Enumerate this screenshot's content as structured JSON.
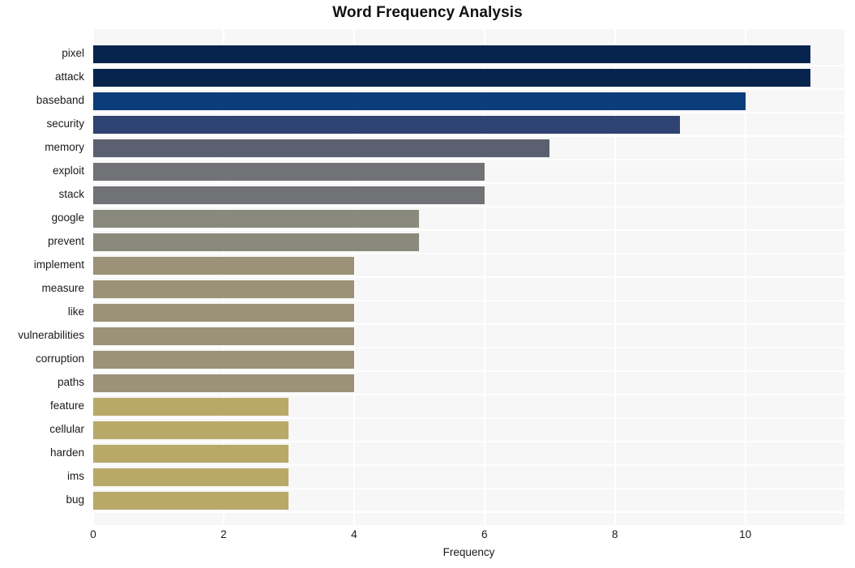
{
  "chart_data": {
    "type": "bar",
    "orientation": "horizontal",
    "title": "Word Frequency Analysis",
    "xlabel": "Frequency",
    "ylabel": "",
    "categories": [
      "pixel",
      "attack",
      "baseband",
      "security",
      "memory",
      "exploit",
      "stack",
      "google",
      "prevent",
      "implement",
      "measure",
      "like",
      "vulnerabilities",
      "corruption",
      "paths",
      "feature",
      "cellular",
      "harden",
      "ims",
      "bug"
    ],
    "values": [
      11,
      11,
      10,
      9,
      7,
      6,
      6,
      5,
      5,
      4,
      4,
      4,
      4,
      4,
      4,
      3,
      3,
      3,
      3,
      3
    ],
    "bar_colors": [
      "#06244d",
      "#06244d",
      "#0b3d7b",
      "#2e4371",
      "#5b6070",
      "#707276",
      "#707276",
      "#8a8a7c",
      "#8a8a7c",
      "#9b9277",
      "#9b9277",
      "#9b9277",
      "#9b9277",
      "#9b9277",
      "#9b9277",
      "#b8a968",
      "#b8a968",
      "#b8a968",
      "#b8a968",
      "#b8a968"
    ],
    "xlim": [
      0,
      11.52
    ],
    "xticks": [
      0,
      2,
      4,
      6,
      8,
      10
    ],
    "xtick_labels": [
      "0",
      "2",
      "4",
      "6",
      "8",
      "10"
    ],
    "grid": true,
    "grid_color": "#ffffff",
    "legend": null,
    "plot_background": "#f7f7f7",
    "figure_background": "#ffffff"
  }
}
